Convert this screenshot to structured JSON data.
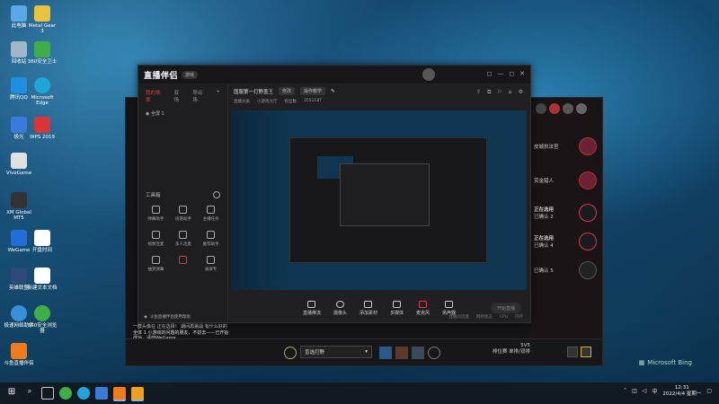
{
  "desktop_icons": [
    {
      "label": "此电脑",
      "color": "#5aa8e6"
    },
    {
      "label": "Metal Gear 3",
      "color": "#e8c23a"
    },
    {
      "label": "回收站",
      "color": "#9fb7c9"
    },
    {
      "label": "360安全卫士",
      "color": "#3fae49"
    },
    {
      "label": "腾讯QQ",
      "color": "#1f8fe0"
    },
    {
      "label": "Microsoft Edge",
      "color": "#1fa6d9"
    },
    {
      "label": "极光",
      "color": "#3a7ad9"
    },
    {
      "label": "WPS 2019",
      "color": "#d9343a"
    },
    {
      "label": "ViveGame",
      "color": "#e0e0e0"
    },
    {
      "label": "XM Global MT5",
      "color": "#333333"
    },
    {
      "label": "WeGame",
      "color": "#1e6fd9"
    },
    {
      "label": "开盘时间",
      "color": "#ffffff"
    },
    {
      "label": "英雄联盟",
      "color": "#2c4a7a"
    },
    {
      "label": "新建文本文档",
      "color": "#ffffff"
    },
    {
      "label": "极速网络助手",
      "color": "#3a8fd9"
    },
    {
      "label": "360安全浏览器",
      "color": "#3fae49"
    },
    {
      "label": "斗鱼直播伴侣",
      "color": "#f07b1a"
    }
  ],
  "app": {
    "logo": "直播伴侣",
    "logo_badge": "游戏",
    "win_buttons": [
      "◻",
      "—",
      "◻",
      "✕"
    ],
    "tabs": [
      {
        "label": "我的场景",
        "active": true
      },
      {
        "label": "双场",
        "active": false
      },
      {
        "label": "导出场",
        "active": false
      }
    ],
    "add_tab": "+",
    "scene_item": "全屏 1",
    "toolbox_title": "工具箱",
    "tools": [
      "弹幕助手",
      "房管助手",
      "主播任务",
      "视频连麦",
      "多人连麦",
      "推荐助手",
      "抽奖弹幕",
      "",
      "录屏专"
    ],
    "stream_title": "国服第一打野盖王",
    "stream_tag1": "修改",
    "stream_category": "操作教学",
    "sub_tags": [
      "直播分类",
      "小游戏大厅",
      "粉丝数",
      "3551187"
    ],
    "controls": [
      "直播推流",
      "摄像头",
      "添加素材",
      "多媒体",
      "麦克风",
      "扬声器"
    ],
    "start_button": "开始直播",
    "footer": [
      "直播间流量",
      "网络状态",
      "CPU",
      "内存"
    ],
    "help": "斗鱼直播伴侣使用帮助"
  },
  "game": {
    "right_slots": [
      {
        "label": "皮城执法官",
        "red": false
      },
      {
        "label": "赏金猎人",
        "red": false
      },
      {
        "label": "正在选用",
        "sub": "已确认 2",
        "red": true
      },
      {
        "label": "正在选用",
        "sub": "已确认 4",
        "red": true
      },
      {
        "label": "",
        "sub": "已确认 5",
        "red": false
      }
    ],
    "chat_lines": [
      "一群头像在 正在选择！ 期间再挑战 有什么好的",
      "全体 1 小游戏的问题的朋友，不妨去——已开始",
      "成功，请前WeGame"
    ],
    "dropdown": "盲选打野",
    "rank_label": "排位赛 单排/双排",
    "rank_count": "5V5"
  },
  "taskbar": {
    "time": "12:31",
    "date": "2022/4/4 星期一",
    "lang": "中"
  },
  "watermark": "Microsoft Bing"
}
